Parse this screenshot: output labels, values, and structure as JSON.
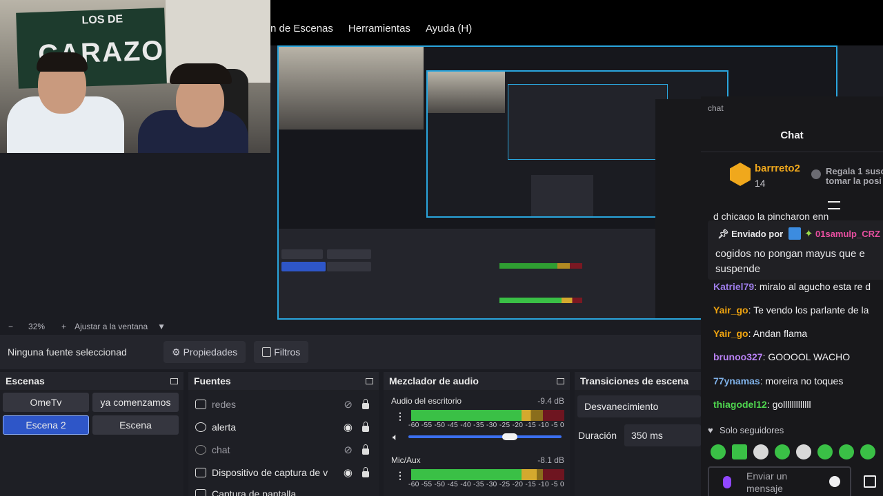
{
  "menu": {
    "items": [
      "n de Escenas",
      "Herramientas",
      "Ayuda (H)"
    ]
  },
  "webcam": {
    "banner_line1": "LOS DE",
    "banner_line2": "CARAZO"
  },
  "zoom": {
    "minus": "−",
    "value": "32%",
    "plus": "+",
    "fit": "Ajustar a la ventana",
    "arrow": "▼"
  },
  "toolbar": {
    "no_source": "Ninguna fuente seleccionad",
    "properties": "Propiedades",
    "filters": "Filtros"
  },
  "scenes": {
    "title": "Escenas",
    "items": [
      "OmeTv",
      "ya comenzamos",
      "Escena 2",
      "Escena"
    ],
    "active": "Escena 2"
  },
  "sources": {
    "title": "Fuentes",
    "items": [
      {
        "label": "redes",
        "visible": false
      },
      {
        "label": "alerta",
        "visible": true
      },
      {
        "label": "chat",
        "visible": false
      },
      {
        "label": "Dispositivo de captura de v",
        "visible": true
      },
      {
        "label": "Captura de pantalla",
        "visible": true
      }
    ]
  },
  "mixer": {
    "title": "Mezclador de audio",
    "scale": "-60 -55 -50 -45 -40 -35 -30 -25 -20 -15 -10 -5  0",
    "channels": [
      {
        "name": "Audio del escritorio",
        "db": "-9.4 dB",
        "level": 0.78,
        "volume": 0.66
      },
      {
        "name": "Mic/Aux",
        "db": "-8.1 dB",
        "level": 0.82,
        "volume": 0.5
      }
    ]
  },
  "transitions": {
    "title": "Transiciones de escena",
    "type": "Desvanecimiento",
    "duration_label": "Duración",
    "duration_value": "350 ms"
  },
  "chat": {
    "dock_label": "chat",
    "title": "Chat",
    "top_user": "barrreto2",
    "top_user_count": "14",
    "gift_line1": "Regala 1 susc",
    "gift_line2": "tomar la posi",
    "cut_text": "d chicago la pincharon enn",
    "pinned_label": "Enviado por",
    "pinned_user": "01samulp_CRZ",
    "pinned_line1": "cogidos no pongan mayus que e",
    "pinned_line2": "suspende",
    "messages": [
      {
        "user": "Katriel79",
        "text": " miralo al agucho esta re d",
        "color": "#9d7ce8"
      },
      {
        "user": "Yair_go",
        "text": " Te vendo los parlante de la",
        "color": "#f2a50f"
      },
      {
        "user": "Yair_go",
        "text": " Andan flama",
        "color": "#f2a50f"
      },
      {
        "user": "brunoo327",
        "text": " GOOOOL WACHO",
        "color": "#b982f5"
      },
      {
        "user": "77ynamas",
        "text": " moreira no toques",
        "color": "#7fb1e8"
      },
      {
        "user": "thiagodel12",
        "text": " golllllllllllll",
        "color": "#4fd64f"
      }
    ],
    "followers_only": "Solo seguidores",
    "input_placeholder_line1": "Enviar un",
    "input_placeholder_line2": "mensaje",
    "accent": "#9147ff"
  }
}
